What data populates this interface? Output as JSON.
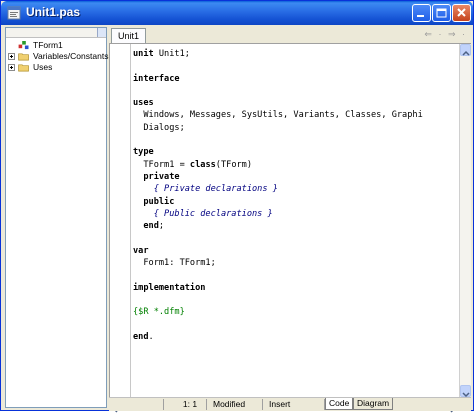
{
  "window": {
    "title": "Unit1.pas",
    "title_bar_color": "#2a6fe6",
    "icons": [
      "app-icon",
      "minimize-icon",
      "maximize-icon",
      "close-icon"
    ]
  },
  "tree": {
    "items": [
      {
        "label": "TForm1",
        "icon": "form-icon"
      },
      {
        "label": "Variables/Constants",
        "icon": "folder-icon"
      },
      {
        "label": "Uses",
        "icon": "folder-icon"
      }
    ]
  },
  "editor": {
    "tab_label": "Unit1",
    "nav": "⇐ · ⇒ ·",
    "lines": [
      [
        {
          "t": "unit",
          "k": "kw"
        },
        {
          "t": " Unit1;"
        }
      ],
      [],
      [
        {
          "t": "interface",
          "k": "kw"
        }
      ],
      [],
      [
        {
          "t": "uses",
          "k": "kw"
        }
      ],
      [
        {
          "t": "  Windows, Messages, SysUtils, Variants, Classes, Graphi"
        }
      ],
      [
        {
          "t": "  Dialogs;"
        }
      ],
      [],
      [
        {
          "t": "type",
          "k": "kw"
        }
      ],
      [
        {
          "t": "  TForm1 = "
        },
        {
          "t": "class",
          "k": "kw"
        },
        {
          "t": "(TForm)"
        }
      ],
      [
        {
          "t": "  "
        },
        {
          "t": "private",
          "k": "kw"
        }
      ],
      [
        {
          "t": "    { Private declarations }",
          "k": "cm"
        }
      ],
      [
        {
          "t": "  "
        },
        {
          "t": "public",
          "k": "kw"
        }
      ],
      [
        {
          "t": "    { Public declarations }",
          "k": "cm"
        }
      ],
      [
        {
          "t": "  "
        },
        {
          "t": "end",
          "k": "kw"
        },
        {
          "t": ";"
        }
      ],
      [],
      [
        {
          "t": "var",
          "k": "kw"
        }
      ],
      [
        {
          "t": "  Form1: TForm1;"
        }
      ],
      [],
      [
        {
          "t": "implementation",
          "k": "kw"
        }
      ],
      [],
      [
        {
          "t": "{$R *.dfm}",
          "k": "dir"
        }
      ],
      [],
      [
        {
          "t": "end",
          "k": "kw"
        },
        {
          "t": "."
        }
      ]
    ]
  },
  "status": {
    "position": "1:  1",
    "modified": "Modified",
    "mode": "Insert",
    "tabs": [
      "Code",
      "Diagram"
    ],
    "active_tab": "Code"
  }
}
